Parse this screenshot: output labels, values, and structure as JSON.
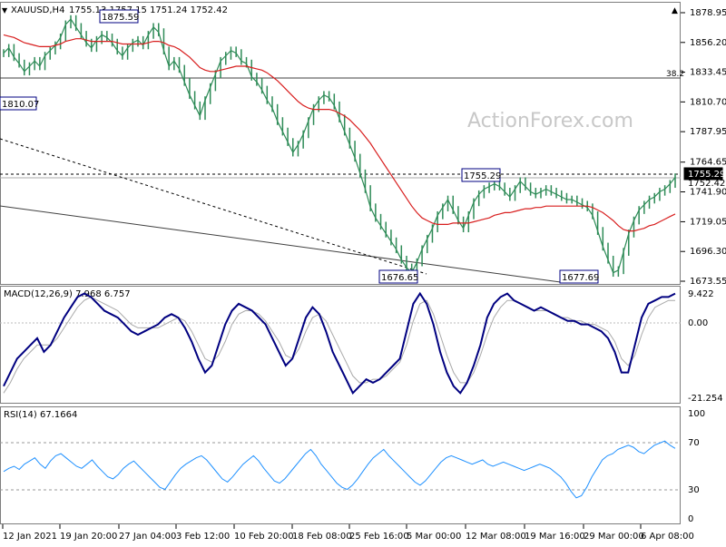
{
  "window": {
    "symbol": "XAUUSD,H4",
    "ohlc": "1755.13 1757.15 1751.24 1752.42",
    "watermark": "ActionForex.com"
  },
  "chart_data": {
    "type": "candlestick",
    "title": "XAUUSD,H4 1755.13 1757.15 1751.24 1752.42",
    "price_axis_ticks": [
      1878.95,
      1856.2,
      1833.45,
      1810.7,
      1787.95,
      1764.65,
      1741.9,
      1719.05,
      1696.3,
      1673.55
    ],
    "current_price": "1755.29",
    "current_close": "1752.42",
    "price_series": [
      1848,
      1852,
      1845,
      1840,
      1834,
      1838,
      1842,
      1838,
      1846,
      1850,
      1854,
      1860,
      1870,
      1874,
      1868,
      1862,
      1856,
      1852,
      1858,
      1862,
      1860,
      1856,
      1850,
      1846,
      1852,
      1856,
      1858,
      1854,
      1862,
      1868,
      1864,
      1850,
      1838,
      1842,
      1836,
      1826,
      1816,
      1808,
      1800,
      1812,
      1822,
      1832,
      1842,
      1846,
      1850,
      1848,
      1842,
      1840,
      1830,
      1826,
      1820,
      1812,
      1806,
      1796,
      1788,
      1780,
      1772,
      1778,
      1786,
      1796,
      1806,
      1812,
      1816,
      1814,
      1808,
      1798,
      1788,
      1778,
      1768,
      1756,
      1744,
      1730,
      1722,
      1716,
      1710,
      1704,
      1698,
      1690,
      1684,
      1680,
      1688,
      1698,
      1706,
      1714,
      1724,
      1730,
      1736,
      1728,
      1720,
      1714,
      1724,
      1734,
      1740,
      1744,
      1746,
      1748,
      1746,
      1742,
      1738,
      1744,
      1750,
      1746,
      1742,
      1740,
      1742,
      1744,
      1742,
      1740,
      1738,
      1736,
      1736,
      1734,
      1732,
      1730,
      1724,
      1712,
      1700,
      1690,
      1680,
      1682,
      1696,
      1710,
      1720,
      1728,
      1732,
      1736,
      1738,
      1742,
      1744,
      1748,
      1753
    ],
    "ema_series": [
      1862,
      1861,
      1860,
      1858,
      1856,
      1855,
      1854,
      1853,
      1853,
      1853,
      1854,
      1855,
      1857,
      1858,
      1859,
      1859,
      1858,
      1857,
      1857,
      1857,
      1857,
      1857,
      1856,
      1855,
      1855,
      1855,
      1855,
      1855,
      1856,
      1857,
      1857,
      1856,
      1854,
      1853,
      1851,
      1848,
      1845,
      1841,
      1837,
      1835,
      1834,
      1834,
      1835,
      1836,
      1837,
      1838,
      1838,
      1838,
      1837,
      1836,
      1835,
      1833,
      1830,
      1827,
      1823,
      1819,
      1815,
      1811,
      1808,
      1806,
      1805,
      1805,
      1805,
      1805,
      1804,
      1802,
      1800,
      1797,
      1793,
      1789,
      1784,
      1779,
      1773,
      1767,
      1761,
      1755,
      1749,
      1743,
      1737,
      1731,
      1726,
      1722,
      1720,
      1718,
      1717,
      1717,
      1717,
      1718,
      1718,
      1718,
      1718,
      1719,
      1720,
      1721,
      1722,
      1724,
      1725,
      1726,
      1726,
      1727,
      1728,
      1729,
      1729,
      1730,
      1730,
      1731,
      1731,
      1731,
      1731,
      1731,
      1731,
      1731,
      1731,
      1731,
      1730,
      1728,
      1726,
      1723,
      1720,
      1716,
      1713,
      1712,
      1712,
      1713,
      1714,
      1716,
      1717,
      1719,
      1721,
      1723,
      1725
    ],
    "levels": [
      {
        "label": "1875.59",
        "value": 1875.59
      },
      {
        "label": "1810.07",
        "value": 1810.07
      },
      {
        "label": "1755.29",
        "value": 1755.29
      },
      {
        "label": "1676.65",
        "value": 1676.65
      },
      {
        "label": "1677.69",
        "value": 1677.69
      }
    ],
    "fib_label": "38.2",
    "fib_value": 1829.5,
    "macd": {
      "title": "MACD(12,26,9) 7.968 6.757",
      "ticks": [
        "9.422",
        "0.00",
        "-21.254"
      ],
      "ylim": [
        -21.254,
        9.422
      ],
      "macd_series": [
        -18,
        -14,
        -10,
        -8,
        -6,
        -4,
        -8,
        -6,
        -2,
        2,
        5,
        8,
        9,
        8,
        6,
        4,
        3,
        2,
        0,
        -2,
        -3,
        -2,
        -1,
        0,
        2,
        3,
        2,
        -1,
        -5,
        -10,
        -14,
        -12,
        -6,
        0,
        4,
        6,
        5,
        4,
        2,
        0,
        -4,
        -8,
        -12,
        -10,
        -4,
        2,
        5,
        3,
        -2,
        -8,
        -12,
        -16,
        -20,
        -18,
        -16,
        -17,
        -16,
        -14,
        -12,
        -10,
        -2,
        6,
        9,
        6,
        0,
        -8,
        -14,
        -18,
        -20,
        -17,
        -12,
        -6,
        2,
        6,
        8,
        9,
        7,
        6,
        5,
        4,
        5,
        4,
        3,
        2,
        1,
        1,
        0,
        0,
        -1,
        -2,
        -4,
        -8,
        -14,
        -14,
        -6,
        2,
        6,
        7,
        8,
        8,
        9
      ],
      "signal_series": [
        -20,
        -17,
        -13,
        -10,
        -8,
        -6,
        -6,
        -6,
        -4,
        -1,
        2,
        5,
        7,
        8,
        7,
        6,
        5,
        4,
        2,
        0,
        -1,
        -1,
        -1,
        -1,
        0,
        1,
        2,
        1,
        -2,
        -6,
        -10,
        -11,
        -9,
        -5,
        0,
        3,
        4,
        4,
        3,
        1,
        -2,
        -5,
        -9,
        -10,
        -7,
        -2,
        2,
        3,
        1,
        -3,
        -7,
        -11,
        -15,
        -17,
        -17,
        -16,
        -16,
        -15,
        -13,
        -11,
        -6,
        1,
        6,
        7,
        3,
        -3,
        -9,
        -14,
        -17,
        -17,
        -14,
        -9,
        -3,
        2,
        5,
        7,
        7,
        6,
        5,
        4,
        4,
        4,
        3,
        2,
        2,
        1,
        1,
        0,
        0,
        -1,
        -2,
        -5,
        -10,
        -12,
        -9,
        -3,
        2,
        5,
        6,
        7,
        7
      ]
    },
    "rsi": {
      "title": "RSI(14) 67.1664",
      "ticks": [
        "100",
        "70",
        "30",
        "0"
      ],
      "ylim": [
        0,
        100
      ],
      "levels": [
        70,
        30
      ],
      "series": [
        45,
        48,
        50,
        47,
        52,
        55,
        58,
        52,
        48,
        55,
        60,
        62,
        58,
        54,
        50,
        48,
        52,
        56,
        50,
        45,
        40,
        38,
        42,
        48,
        52,
        55,
        50,
        45,
        40,
        35,
        30,
        28,
        35,
        42,
        48,
        52,
        55,
        58,
        60,
        56,
        50,
        44,
        38,
        35,
        40,
        46,
        52,
        56,
        60,
        55,
        48,
        42,
        36,
        34,
        38,
        44,
        50,
        56,
        62,
        66,
        60,
        52,
        46,
        40,
        34,
        30,
        28,
        32,
        38,
        45,
        52,
        58,
        62,
        66,
        60,
        55,
        50,
        45,
        40,
        35,
        32,
        36,
        42,
        48,
        54,
        58,
        60,
        58,
        56,
        54,
        52,
        54,
        56,
        52,
        50,
        52,
        54,
        52,
        50,
        48,
        46,
        48,
        50,
        52,
        50,
        48,
        44,
        40,
        34,
        26,
        20,
        22,
        30,
        40,
        48,
        56,
        60,
        62,
        66,
        68,
        70,
        68,
        64,
        62,
        66,
        70,
        72,
        74,
        70,
        67
      ]
    },
    "x_tick_labels": [
      "12 Jan 2021",
      "19 Jan 20:00",
      "27 Jan 04:00",
      "3 Feb 12:00",
      "10 Feb 20:00",
      "18 Feb 08:00",
      "25 Feb 16:00",
      "5 Mar 00:00",
      "12 Mar 08:00",
      "19 Mar 16:00",
      "29 Mar 00:00",
      "6 Apr 08:00"
    ]
  },
  "colors": {
    "candle": "#2e8b57",
    "ema": "#d81e1e",
    "macd": "#000080",
    "signal": "#a9a9a9",
    "rsi": "#1e90ff",
    "tag_border": "#000080",
    "watermark": "#c8c8c8"
  },
  "icons": {
    "dropdown": "chevron-down-icon",
    "scroll": "scroll-up-icon"
  }
}
